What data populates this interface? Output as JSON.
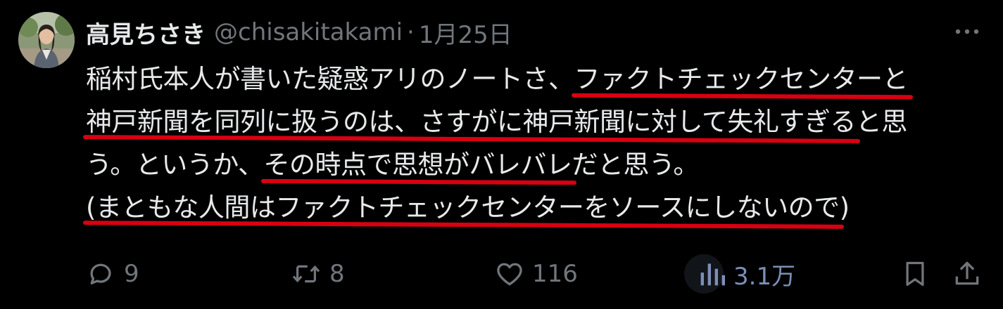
{
  "tweet": {
    "author_name": "高見ちさき",
    "handle": "@chisakitakami",
    "separator": "·",
    "date": "1月25日",
    "more_icon": "more-horizontal-icon",
    "avatar": "user-avatar-photo",
    "lines": [
      {
        "pre": "稲村氏本人が書いた疑惑アリのノートさ、",
        "ul": "ファクトチェックセンターと",
        "post": ""
      },
      {
        "pre": "",
        "ul": "神戸新聞を同列に扱うのは、さすがに神戸新聞に対して失礼すぎる",
        "post": "と思"
      },
      {
        "pre": "う。というか、",
        "ul": "その時点で思想がバレバレ",
        "post": "だと思う。"
      },
      {
        "pre": "",
        "ul": "(まともな人間はファクトチェックセンターをソースにしないので",
        "post": ")"
      }
    ],
    "underline_color": "#d90011"
  },
  "actions": {
    "reply": {
      "icon": "reply-icon",
      "count": "9"
    },
    "retweet": {
      "icon": "retweet-icon",
      "count": "8"
    },
    "like": {
      "icon": "heart-icon",
      "count": "116"
    },
    "views": {
      "icon": "views-bar-chart-icon",
      "count": "3.1万"
    },
    "bookmark": {
      "icon": "bookmark-icon"
    },
    "share": {
      "icon": "share-icon"
    }
  }
}
